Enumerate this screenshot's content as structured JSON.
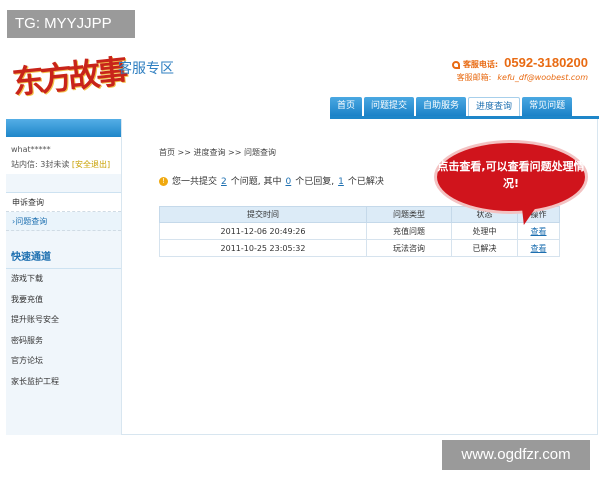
{
  "watermark_top": "TG: MYYJJPP",
  "watermark_bottom": "www.ogdfzr.com",
  "header": {
    "logo_text": "东方故事",
    "logo_subtitle": "客服专区",
    "phone_label": "客服电话:",
    "phone": "0592-3180200",
    "email_label": "客服邮箱:",
    "email": "kefu_df@woobest.com"
  },
  "nav": {
    "tabs": [
      "首页",
      "问题提交",
      "自助服务",
      "进度查询",
      "常见问题"
    ],
    "active": "进度查询"
  },
  "sidebar": {
    "username": "what*****",
    "messages_prefix": "站内信: 3封未读",
    "logout": "[安全退出]",
    "menu": [
      "申诉查询",
      "›问题查询"
    ],
    "quick_title": "快速通道",
    "quick_links": [
      "游戏下载",
      "我要充值",
      "提升账号安全",
      "密码服务",
      "官方论坛",
      "家长监护工程"
    ]
  },
  "main": {
    "breadcrumb": "首页 >> 进度查询 >> 问题查询",
    "summary": {
      "warn_icon": "!",
      "prefix": "您一共提交",
      "total": "2",
      "mid1": "个问题, 其中",
      "replied": "0",
      "mid2": "个已回复,",
      "solved": "1",
      "suffix": "个已解决"
    },
    "table": {
      "headers": [
        "提交时间",
        "问题类型",
        "状态",
        "操作"
      ],
      "rows": [
        [
          "2011-12-06 20:49:26",
          "充值问题",
          "处理中",
          "查看"
        ],
        [
          "2011-10-25 23:05:32",
          "玩法咨询",
          "已解决",
          "查看"
        ]
      ]
    },
    "bubble": "点击查看,可以查看问题处理情况!"
  }
}
